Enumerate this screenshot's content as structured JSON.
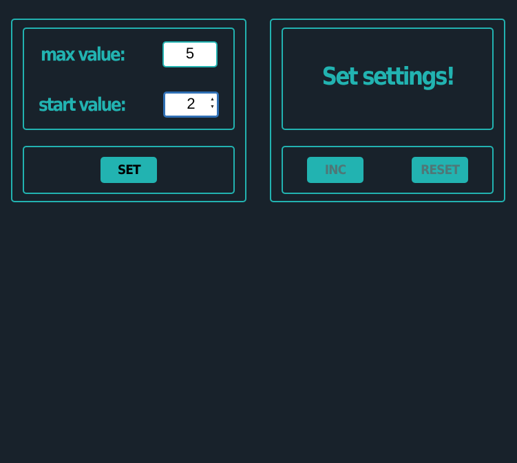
{
  "settings_panel": {
    "max_value_label": "max value:",
    "max_value": "5",
    "start_value_label": "start value:",
    "start_value": "2",
    "set_button_label": "SET"
  },
  "counter_panel": {
    "display_message": "Set settings!",
    "inc_button_label": "INC",
    "reset_button_label": "RESET"
  },
  "colors": {
    "background": "#18222b",
    "accent": "#22b3b1",
    "disabled_text": "#4f7777"
  }
}
